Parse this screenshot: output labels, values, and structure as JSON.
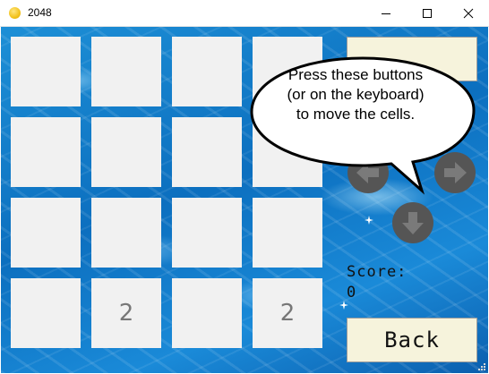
{
  "window": {
    "title": "2048",
    "icon": "coin-icon",
    "controls": [
      "minimize-icon",
      "maximize-icon",
      "close-icon"
    ]
  },
  "board": {
    "rows": [
      [
        "",
        "",
        "",
        ""
      ],
      [
        "",
        "",
        "",
        ""
      ],
      [
        "",
        "",
        "",
        ""
      ],
      [
        "",
        "2",
        "",
        "2"
      ]
    ]
  },
  "tutorial": {
    "lines": [
      "Press these buttons",
      "(or on the keyboard)",
      "to move the cells."
    ]
  },
  "controls": {
    "arrows": [
      "arrow-left-icon",
      "arrow-right-icon",
      "arrow-down-icon"
    ]
  },
  "score": {
    "label": "Score:",
    "value": "0"
  },
  "back_label": "Back",
  "colors": {
    "tile": "#f1f1f1",
    "tile_text": "#777777",
    "button_bg": "#f6f3dc",
    "arrow": "#555555",
    "water": "#0c6fbf"
  }
}
